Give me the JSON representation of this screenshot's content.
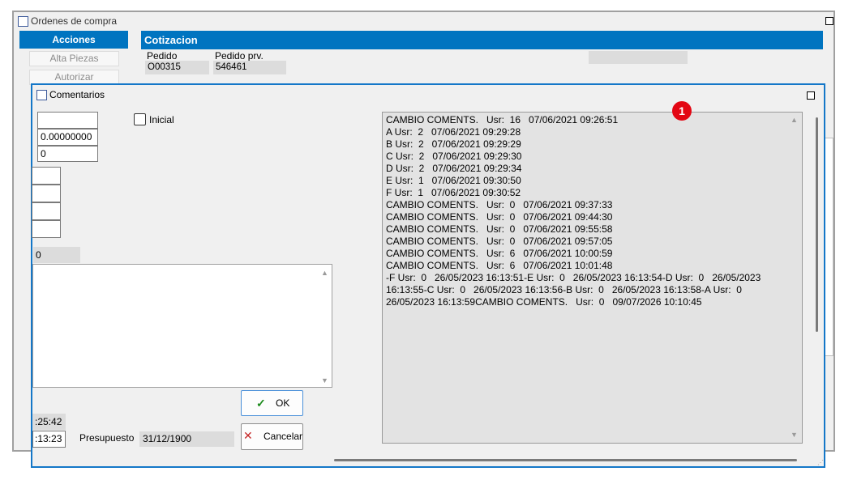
{
  "background_window": {
    "title": "Ordenes de compra",
    "actions_header": "Acciones",
    "actions": [
      "Alta Piezas",
      "Autorizar"
    ],
    "section_header": "Cotizacion",
    "fields": [
      {
        "label": "Pedido",
        "value": "O00315"
      },
      {
        "label": "Pedido prv.",
        "value": "546461"
      }
    ]
  },
  "dialog": {
    "title": "Comentarios",
    "inputs": [
      "",
      "0.00000000",
      "0"
    ],
    "small_inputs": [
      "",
      "",
      "",
      ""
    ],
    "checkbox_label": "Inicial",
    "readonly_value": "0",
    "time_fields": [
      ":25:42",
      ":13:23"
    ],
    "presupuesto_label": "Presupuesto",
    "presupuesto_value": "31/12/1900",
    "ok_label": "OK",
    "cancel_label": "Cancelar",
    "badge": "1",
    "log": "CAMBIO COMENTS.   Usr:  16   07/06/2021 09:26:51\nA Usr:  2   07/06/2021 09:29:28\nB Usr:  2   07/06/2021 09:29:29\nC Usr:  2   07/06/2021 09:29:30\nD Usr:  2   07/06/2021 09:29:34\nE Usr:  1   07/06/2021 09:30:50\nF Usr:  1   07/06/2021 09:30:52\nCAMBIO COMENTS.   Usr:  0   07/06/2021 09:37:33\nCAMBIO COMENTS.   Usr:  0   07/06/2021 09:44:30\nCAMBIO COMENTS.   Usr:  0   07/06/2021 09:55:58\nCAMBIO COMENTS.   Usr:  0   07/06/2021 09:57:05\nCAMBIO COMENTS.   Usr:  6   07/06/2021 10:00:59\nCAMBIO COMENTS.   Usr:  6   07/06/2021 10:01:48\n-F Usr:  0   26/05/2023 16:13:51-E Usr:  0   26/05/2023 16:13:54-D Usr:  0   26/05/2023 16:13:55-C Usr:  0   26/05/2023 16:13:56-B Usr:  0   26/05/2023 16:13:58-A Usr:  0   26/05/2023 16:13:59CAMBIO COMENTS.   Usr:  0   09/07/2026 10:10:45"
  },
  "colors": {
    "header_blue": "#0074c0",
    "dialog_border": "#1477c8",
    "badge_red": "#e30613"
  }
}
